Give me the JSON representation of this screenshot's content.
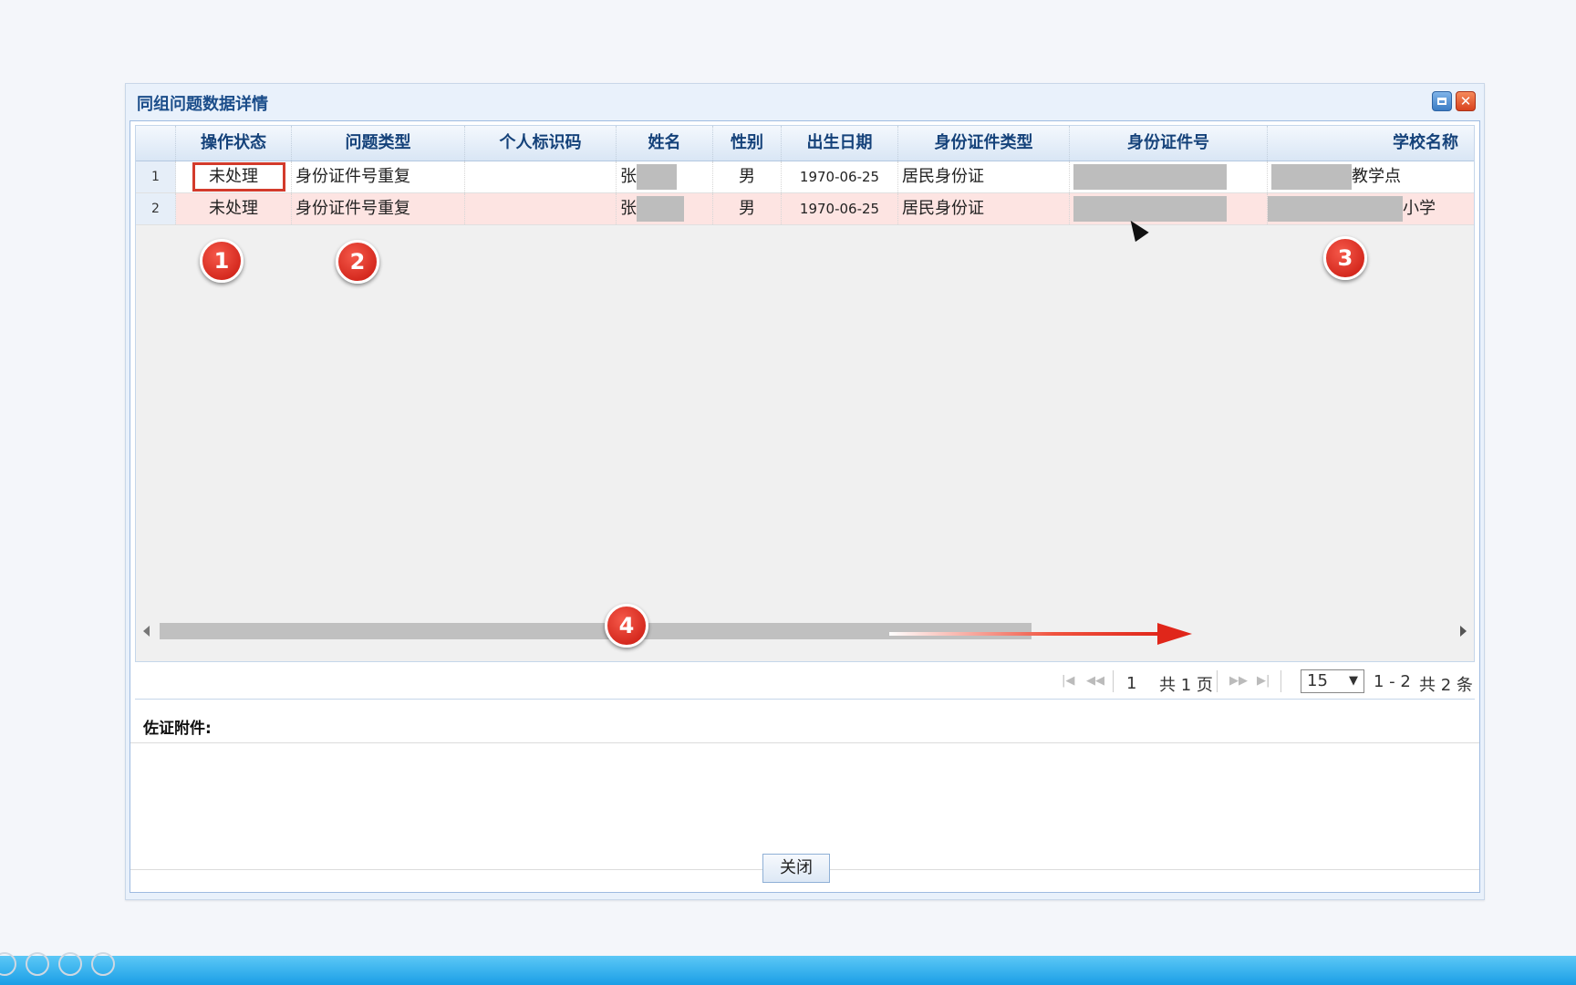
{
  "dialog": {
    "title": "同组问题数据详情",
    "maximize_icon": "window-maximize-icon",
    "close_icon": "close-icon",
    "close_glyph": "✕"
  },
  "grid": {
    "columns": [
      "",
      "操作状态",
      "问题类型",
      "个人标识码",
      "姓名",
      "性别",
      "出生日期",
      "身份证件类型",
      "身份证件号",
      "学校名称"
    ],
    "rows": [
      {
        "num": "1",
        "status": "未处理",
        "problem_type": "身份证件号重复",
        "personal_id": "",
        "name": "张",
        "gender": "男",
        "birth": "1970-06-25",
        "id_type": "居民身份证",
        "id_no": "",
        "school": "教学点"
      },
      {
        "num": "2",
        "status": "未处理",
        "problem_type": "身份证件号重复",
        "personal_id": "",
        "name": "张",
        "gender": "男",
        "birth": "1970-06-25",
        "id_type": "居民身份证",
        "id_no": "",
        "school": "小学"
      }
    ],
    "selected_row_color": "#fde4e2"
  },
  "markers": [
    "1",
    "2",
    "3",
    "4"
  ],
  "pager": {
    "first_icon": "first-page-icon",
    "prev_icon": "prev-page-icon",
    "next_icon": "next-page-icon",
    "last_icon": "last-page-icon",
    "current_page": "1",
    "total_pages": "共 1 页",
    "page_size": "15",
    "range": "1 - 2",
    "total": "共 2 条"
  },
  "attachments": {
    "label": "佐证附件:"
  },
  "footer": {
    "close_label": "关闭"
  },
  "colors": {
    "accent": "#1b4d8a",
    "marker": "#d61e12",
    "taskbar": "#1a9ee6"
  }
}
